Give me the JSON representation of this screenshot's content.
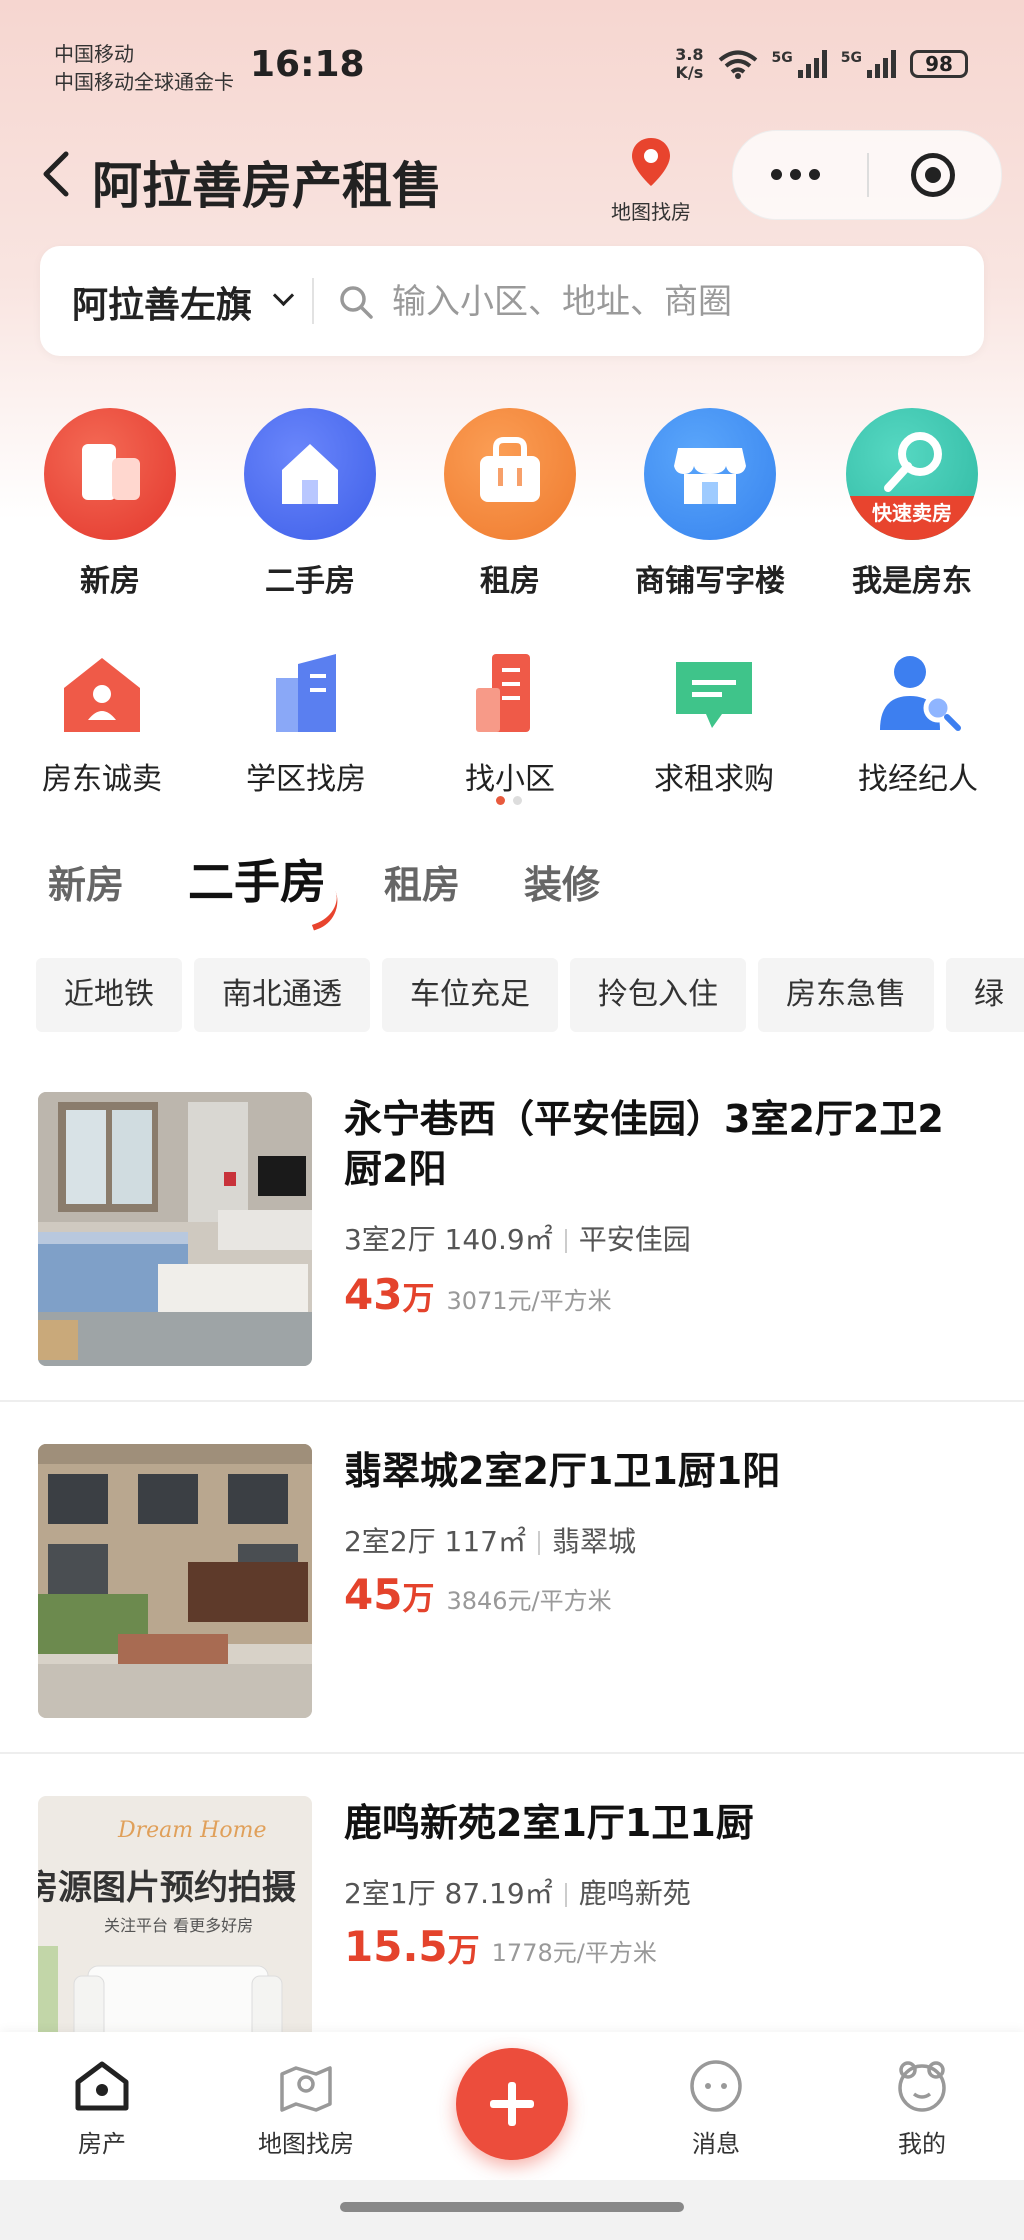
{
  "status_bar": {
    "carrier_1": "中国移动",
    "carrier_2": "中国移动全球通金卡",
    "time": "16:18",
    "net_speed_value": "3.8",
    "net_speed_unit": "K/s",
    "sig_label_1": "5G",
    "sig_label_2": "5G",
    "battery": "98"
  },
  "header": {
    "title": "阿拉善房产租售",
    "map_label": "地图找房"
  },
  "search": {
    "city": "阿拉善左旗",
    "placeholder": "输入小区、地址、商圈"
  },
  "grid1": [
    {
      "label": "新房",
      "icon": "new-house-icon",
      "color": "#e8493c"
    },
    {
      "label": "二手房",
      "icon": "second-hand-house-icon",
      "color": "#4a6cf0"
    },
    {
      "label": "租房",
      "icon": "rent-bag-icon",
      "color": "#f2873a"
    },
    {
      "label": "商铺写字楼",
      "icon": "shop-icon",
      "color": "#3e8cf2"
    },
    {
      "label": "我是房东",
      "icon": "landlord-key-icon",
      "color": "#3ec6b0",
      "badge": "快速卖房"
    }
  ],
  "grid2": [
    {
      "label": "房东诚卖",
      "icon": "landlord-sell-icon"
    },
    {
      "label": "学区找房",
      "icon": "school-district-icon"
    },
    {
      "label": "找小区",
      "icon": "community-icon"
    },
    {
      "label": "求租求购",
      "icon": "request-chat-icon"
    },
    {
      "label": "找经纪人",
      "icon": "agent-search-icon"
    }
  ],
  "tabs": [
    "新房",
    "二手房",
    "租房",
    "装修"
  ],
  "active_tab": "二手房",
  "chips": [
    "近地铁",
    "南北通透",
    "车位充足",
    "拎包入住",
    "房东急售",
    "绿"
  ],
  "listings": [
    {
      "title": "永宁巷西（平安佳园）3室2厅2卫2厨2阳",
      "layout": "3室2厅 140.9㎡",
      "community": "平安佳园",
      "price": "43",
      "price_unit": "万",
      "unit_price": "3071元/平方米"
    },
    {
      "title": "翡翠城2室2厅1卫1厨1阳",
      "layout": "2室2厅 117㎡",
      "community": "翡翠城",
      "price": "45",
      "price_unit": "万",
      "unit_price": "3846元/平方米"
    },
    {
      "title": "鹿鸣新苑2室1厅1卫1厨",
      "layout": "2室1厅 87.19㎡",
      "community": "鹿鸣新苑",
      "price": "15.5",
      "price_unit": "万",
      "unit_price": "1778元/平方米",
      "thumb_text_script": "Dream Home",
      "thumb_text_main": "房源图片预约拍摄",
      "thumb_text_sub": "关注平台 看更多好房"
    }
  ],
  "bottom_nav": [
    {
      "label": "房产",
      "icon": "home-icon"
    },
    {
      "label": "地图找房",
      "icon": "map-icon"
    },
    {
      "label": "",
      "icon": "plus-icon"
    },
    {
      "label": "消息",
      "icon": "message-icon"
    },
    {
      "label": "我的",
      "icon": "profile-icon"
    }
  ],
  "colors": {
    "accent": "#e4432c",
    "header_bg": "#f6d6d0"
  }
}
